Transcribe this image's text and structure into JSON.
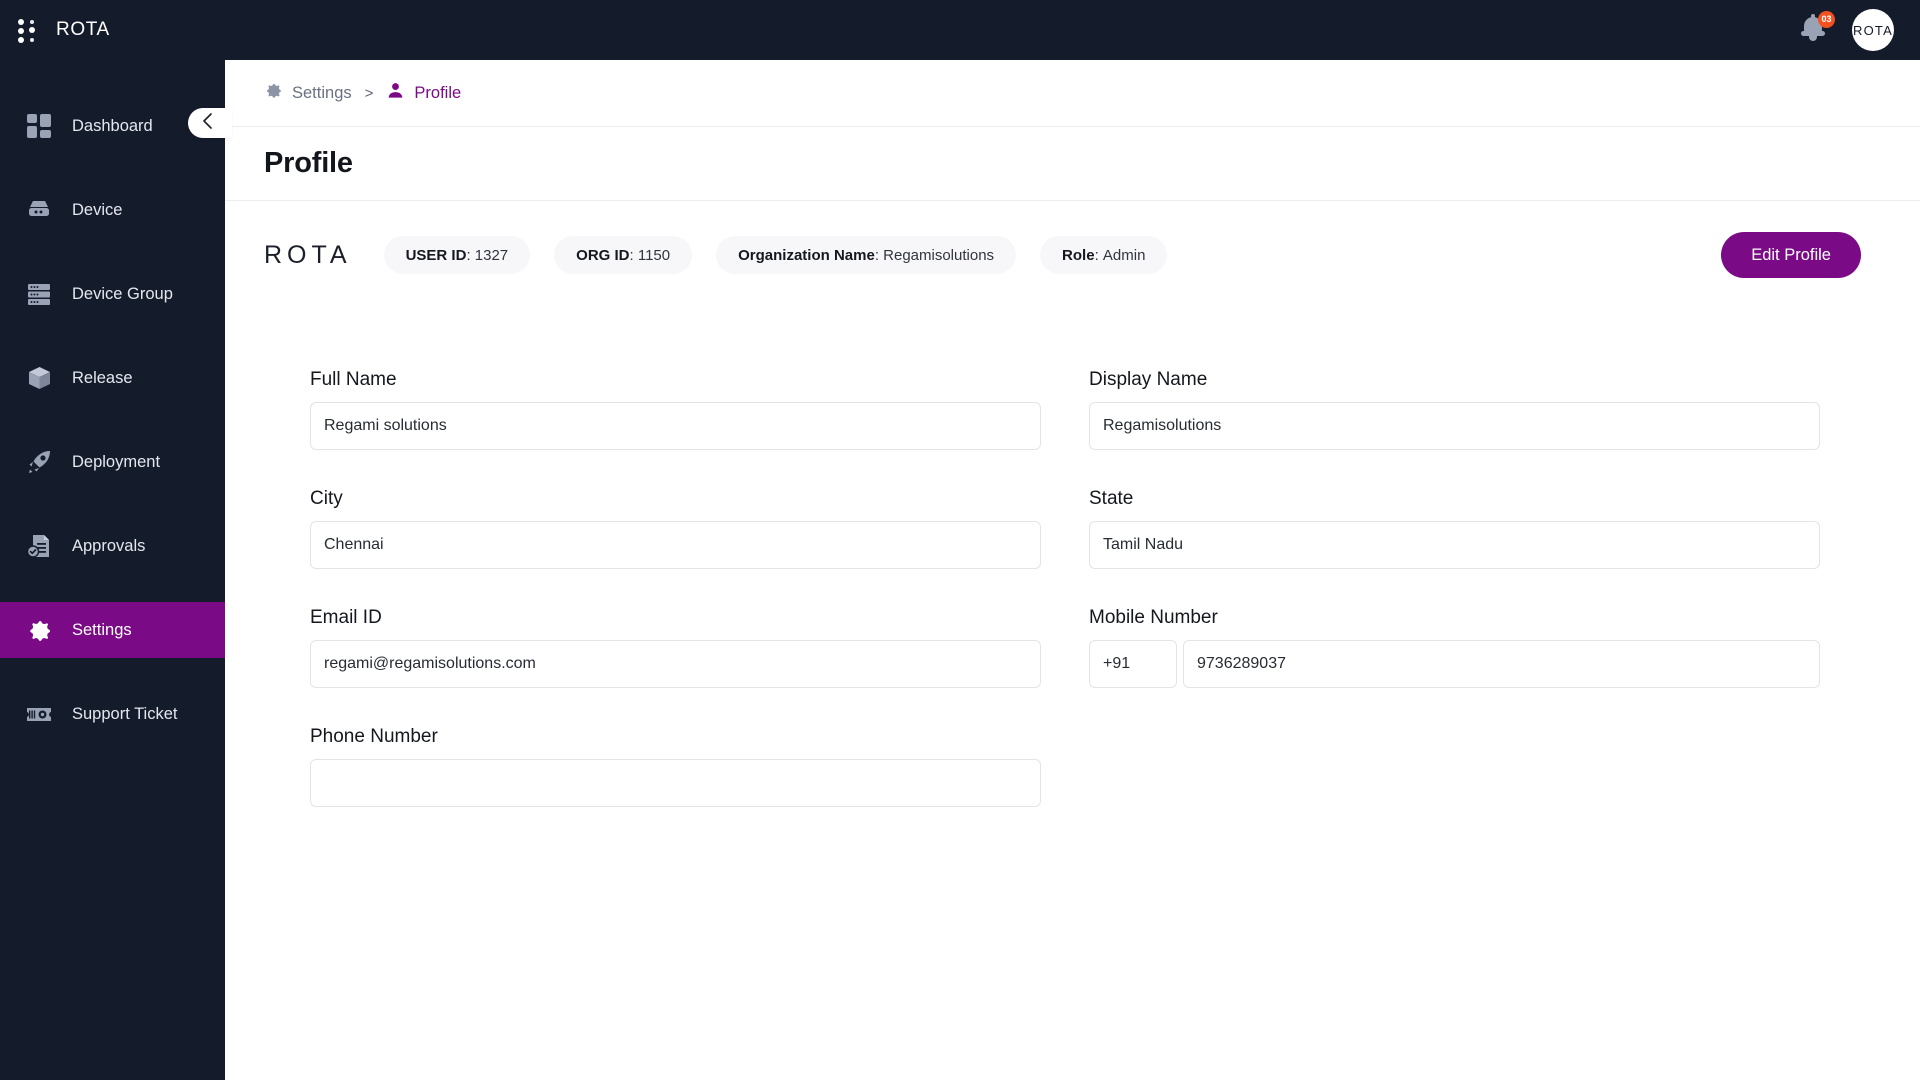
{
  "topbar": {
    "brand": "ROTA",
    "menu_icon": "grid-dots-icon",
    "notification_icon": "bell-icon",
    "notification_count": "03",
    "avatar_label": "ROTA"
  },
  "sidebar": {
    "collapse_icon": "chevron-left-icon",
    "items": [
      {
        "label": "Dashboard",
        "icon": "dashboard-icon",
        "active": false
      },
      {
        "label": "Device",
        "icon": "device-icon",
        "active": false
      },
      {
        "label": "Device Group",
        "icon": "device-group-icon",
        "active": false
      },
      {
        "label": "Release",
        "icon": "release-box-icon",
        "active": false
      },
      {
        "label": "Deployment",
        "icon": "rocket-icon",
        "active": false
      },
      {
        "label": "Approvals",
        "icon": "approvals-icon",
        "active": false
      },
      {
        "label": "Settings",
        "icon": "gear-icon",
        "active": true
      },
      {
        "label": "Support Ticket",
        "icon": "ticket-icon",
        "active": false
      }
    ]
  },
  "breadcrumb": {
    "parent": "Settings",
    "parent_icon": "gear-icon",
    "separator": ">",
    "current": "Profile",
    "current_icon": "user-icon"
  },
  "page": {
    "title": "Profile"
  },
  "info_bar": {
    "logo_text": "ROTA",
    "chips": [
      {
        "label": "USER ID",
        "value": "1327"
      },
      {
        "label": "ORG ID",
        "value": "1150"
      },
      {
        "label": "Organization Name",
        "value": "Regamisolutions"
      },
      {
        "label": "Role",
        "value": "Admin"
      }
    ],
    "edit_button": "Edit Profile",
    "accent_color": "#7B0A86"
  },
  "form": {
    "fields": [
      {
        "label": "Full Name",
        "value": "Regami solutions",
        "placeholder": ""
      },
      {
        "label": "Display Name",
        "value": "Regamisolutions",
        "placeholder": ""
      },
      {
        "label": "City",
        "value": "Chennai",
        "placeholder": ""
      },
      {
        "label": "State",
        "value": "Tamil Nadu",
        "placeholder": ""
      },
      {
        "label": "Email ID",
        "value": "regami@regamisolutions.com",
        "placeholder": ""
      }
    ],
    "mobile": {
      "label": "Mobile Number",
      "country_code": "+91",
      "number": "9736289037"
    },
    "phone": {
      "label": "Phone Number",
      "value": "",
      "placeholder": ""
    }
  }
}
